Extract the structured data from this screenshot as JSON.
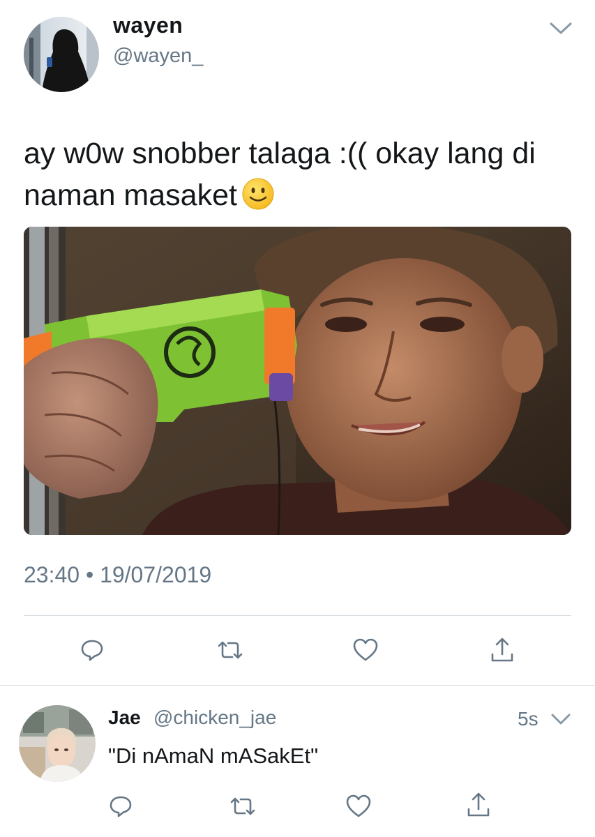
{
  "tweet": {
    "author_name": "wayen",
    "author_handle": "@wayen_",
    "text": "ay w0w snobber talaga :(( okay lang di naman masaket",
    "emoji": "slightly-smiling-face",
    "timestamp": "23:40 • 19/07/2019",
    "media": "photo-person-holding-toy-gun"
  },
  "actions": [
    "reply-icon",
    "retweet-icon",
    "like-icon",
    "share-icon"
  ],
  "reply": {
    "author_name": "Jae",
    "author_handle": "@chicken_jae",
    "time": "5s",
    "text": "\"Di nAmaN mASakEt\""
  },
  "colors": {
    "text": "#14171a",
    "secondary": "#657786",
    "divider": "#d8dde1",
    "icon": "#657786"
  }
}
